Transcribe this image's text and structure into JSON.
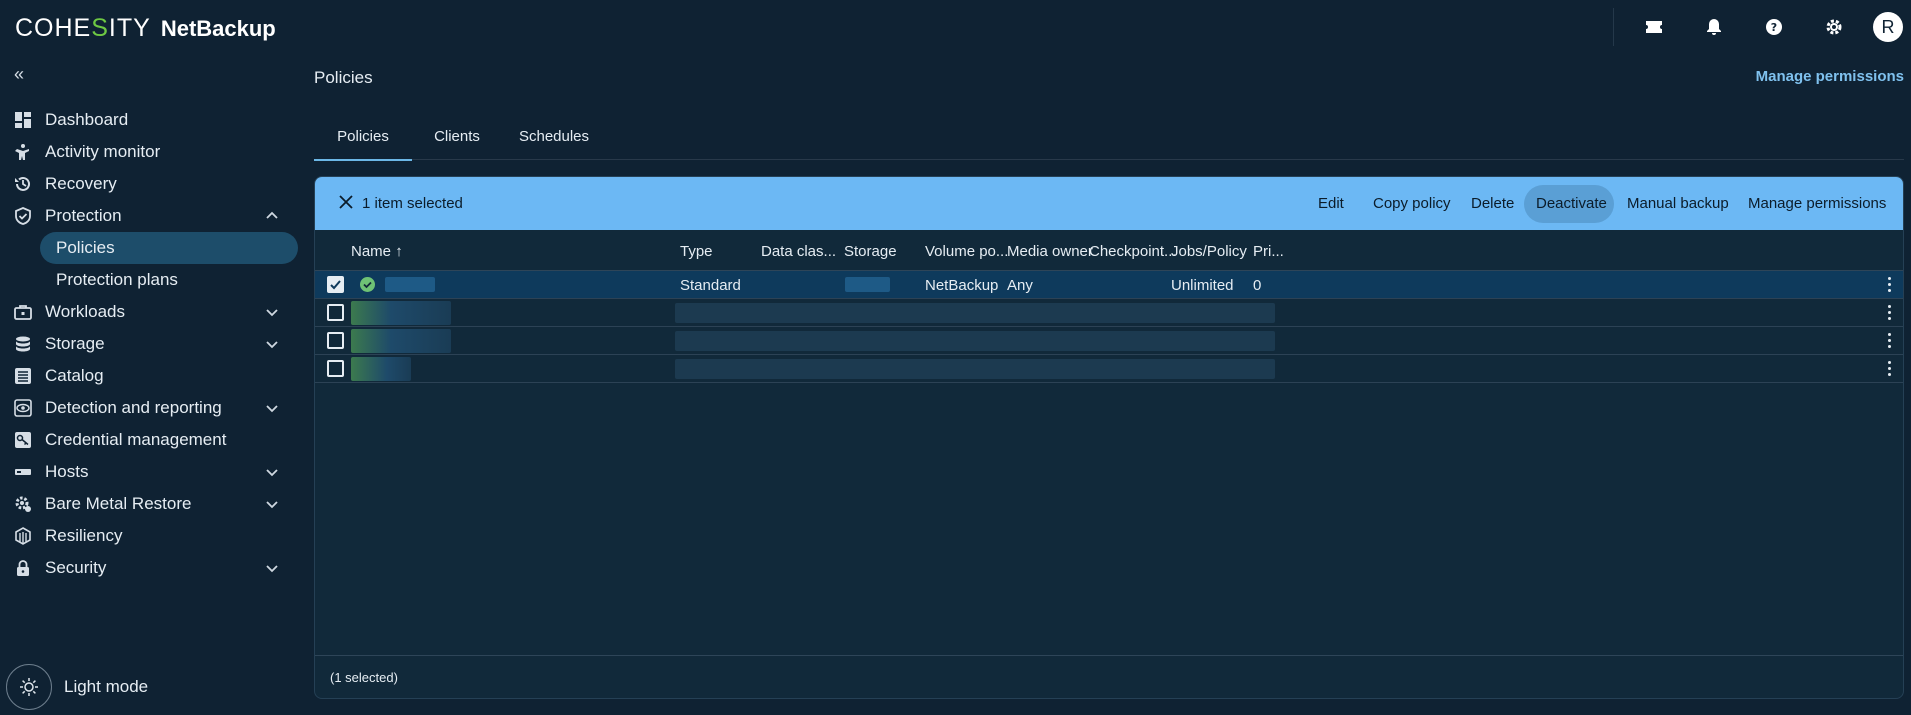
{
  "brand": {
    "logo_pre": "COHE",
    "logo_s": "S",
    "logo_post": "ITY",
    "product": "NetBackup"
  },
  "user": {
    "initial": "R"
  },
  "sidebar": {
    "collapse_glyph": "«",
    "items": [
      {
        "label": "Dashboard",
        "icon": "dashboard-icon"
      },
      {
        "label": "Activity monitor",
        "icon": "activity-icon"
      },
      {
        "label": "Recovery",
        "icon": "history-icon"
      },
      {
        "label": "Protection",
        "icon": "shield-icon",
        "expanded": true
      },
      {
        "label": "Workloads",
        "icon": "briefcase-icon"
      },
      {
        "label": "Storage",
        "icon": "database-icon"
      },
      {
        "label": "Catalog",
        "icon": "list-icon"
      },
      {
        "label": "Detection and reporting",
        "icon": "eye-icon"
      },
      {
        "label": "Credential management",
        "icon": "key-icon"
      },
      {
        "label": "Hosts",
        "icon": "server-icon"
      },
      {
        "label": "Bare Metal Restore",
        "icon": "gear-icon"
      },
      {
        "label": "Resiliency",
        "icon": "cube-icon"
      },
      {
        "label": "Security",
        "icon": "lock-icon"
      }
    ],
    "protection_children": [
      {
        "label": "Policies",
        "active": true
      },
      {
        "label": "Protection plans",
        "active": false
      }
    ],
    "light_mode_label": "Light mode"
  },
  "main": {
    "title": "Policies",
    "manage_permissions_link": "Manage permissions",
    "tabs": [
      {
        "label": "Policies",
        "active": true
      },
      {
        "label": "Clients",
        "active": false
      },
      {
        "label": "Schedules",
        "active": false
      }
    ]
  },
  "action_bar": {
    "selected_text": "1 item selected",
    "actions": [
      "Edit",
      "Copy policy",
      "Delete",
      "Deactivate",
      "Manual backup",
      "Manage permissions"
    ]
  },
  "table": {
    "columns": [
      "Name",
      "Type",
      "Data clas...",
      "Storage",
      "Volume po...",
      "Media owner",
      "Checkpoint...",
      "Jobs/Policy",
      "Pri..."
    ],
    "sort_arrow": "↑",
    "rows": [
      {
        "selected": true,
        "type": "Standard",
        "volume_pool": "NetBackup",
        "media_owner": "Any",
        "jobs_policy": "Unlimited",
        "priority": "0"
      }
    ]
  },
  "footer": {
    "selection_text": "(1 selected)"
  },
  "colors": {
    "accent": "#6cb8f4",
    "background": "#0f2233",
    "status_ok": "#6ec275",
    "link": "#7fc1ee"
  }
}
